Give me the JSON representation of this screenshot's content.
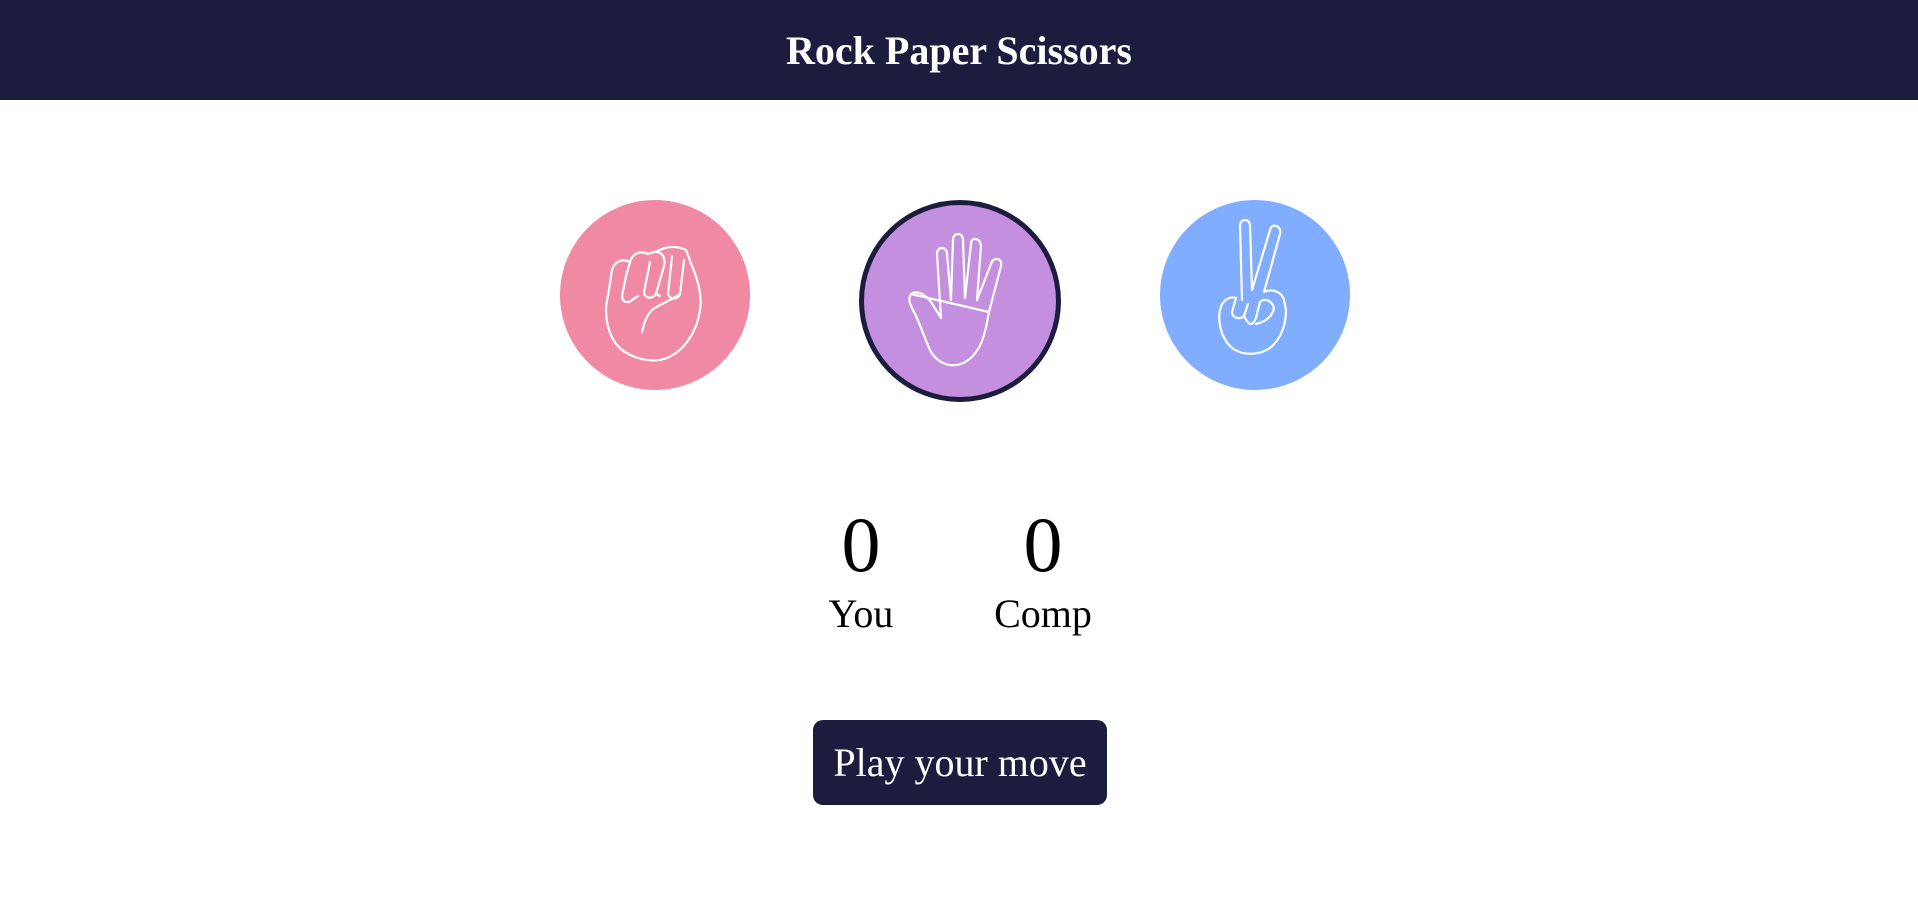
{
  "header": {
    "title": "Rock Paper Scissors"
  },
  "choices": [
    {
      "id": "rock",
      "icon": "fist-icon",
      "color": "#f08aa4"
    },
    {
      "id": "paper",
      "icon": "open-hand-icon",
      "color": "#c48fde",
      "selected": true
    },
    {
      "id": "scissors",
      "icon": "peace-hand-icon",
      "color": "#80adff"
    }
  ],
  "scoreboard": {
    "user": {
      "score": "0",
      "label": "You"
    },
    "computer": {
      "score": "0",
      "label": "Comp"
    }
  },
  "actions": {
    "play_label": "Play your move"
  },
  "colors": {
    "header_bg": "#1c1d3e",
    "button_bg": "#1c1d3e",
    "selected_border": "#1c1d3e"
  }
}
